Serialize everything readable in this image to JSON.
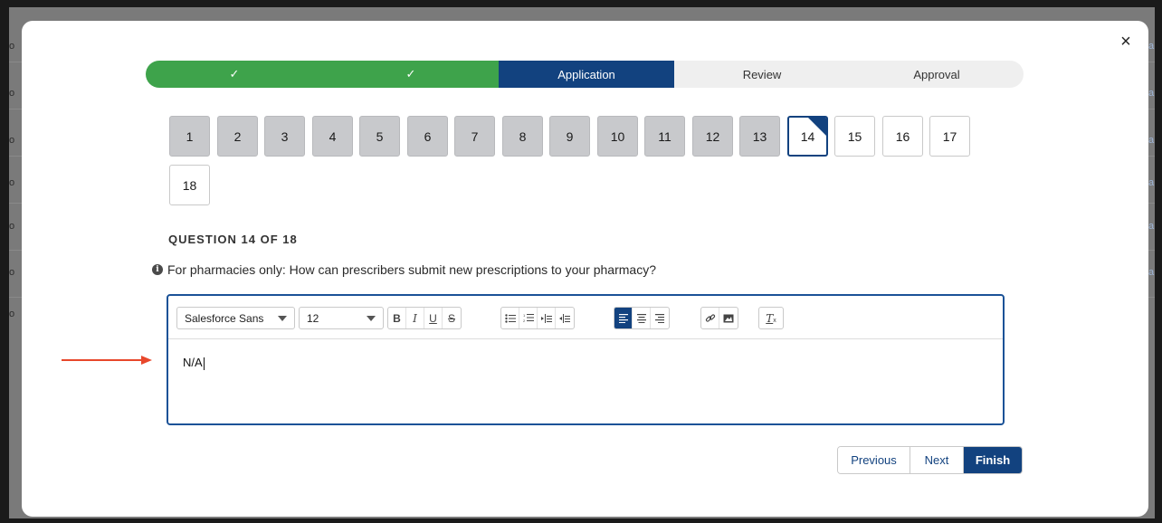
{
  "background": {
    "left_edge_text": [
      "o",
      "o",
      "o",
      "o",
      "o",
      "o",
      "o"
    ],
    "right_edge_text": [
      "a",
      "a",
      "a",
      "a",
      "a",
      "a"
    ]
  },
  "modal": {
    "close_label": "×"
  },
  "path": {
    "steps": [
      {
        "label": "✓",
        "state": "done"
      },
      {
        "label": "✓",
        "state": "done"
      },
      {
        "label": "Application",
        "state": "active"
      },
      {
        "label": "Review",
        "state": "todo"
      },
      {
        "label": "Approval",
        "state": "todo"
      }
    ]
  },
  "questions": {
    "numbers": [
      "1",
      "2",
      "3",
      "4",
      "5",
      "6",
      "7",
      "8",
      "9",
      "10",
      "11",
      "12",
      "13",
      "14",
      "15",
      "16",
      "17",
      "18"
    ],
    "current": "14",
    "heading": "QUESTION 14 OF 18",
    "prompt": "For pharmacies only: How can prescribers submit new prescriptions to your pharmacy?",
    "info_icon": "info-icon"
  },
  "editor": {
    "font_family_value": "Salesforce Sans",
    "font_size_value": "12",
    "content": "N/A",
    "format_buttons": [
      "bold-icon",
      "italic-icon",
      "underline-icon",
      "strikethrough-icon"
    ],
    "list_buttons": [
      "bullet-list-icon",
      "numbered-list-icon",
      "indent-icon",
      "outdent-icon"
    ],
    "align_buttons": [
      "align-left-icon",
      "align-center-icon",
      "align-right-icon"
    ],
    "insert_buttons": [
      "link-icon",
      "image-icon"
    ],
    "clear_button": "clear-formatting-icon"
  },
  "nav": {
    "previous_label": "Previous",
    "next_label": "Next",
    "finish_label": "Finish"
  },
  "colors": {
    "done": "#3ea34b",
    "active": "#12427f",
    "todo": "#efefef",
    "arrow": "#e8472b"
  }
}
